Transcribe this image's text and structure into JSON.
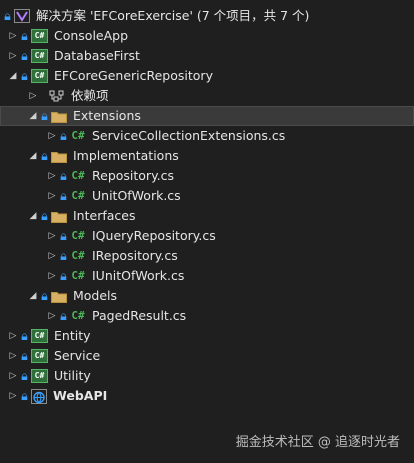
{
  "solution": {
    "label": "解决方案 'EFCoreExercise' (7 个项目，共 7 个)"
  },
  "projects": {
    "console_app": "ConsoleApp",
    "database_first": "DatabaseFirst",
    "generic_repo": "EFCoreGenericRepository",
    "entity": "Entity",
    "service": "Service",
    "utility": "Utility",
    "webapi": "WebAPI"
  },
  "repo": {
    "dependencies": "依赖项",
    "extensions": "Extensions",
    "service_collection_extensions": "ServiceCollectionExtensions.cs",
    "implementations": "Implementations",
    "repository": "Repository.cs",
    "unit_of_work": "UnitOfWork.cs",
    "interfaces": "Interfaces",
    "i_query_repository": "IQueryRepository.cs",
    "i_repository": "IRepository.cs",
    "i_unit_of_work": "IUnitOfWork.cs",
    "models": "Models",
    "paged_result": "PagedResult.cs"
  },
  "icons": {
    "project_badge": "C#",
    "cs_file": "C#"
  },
  "colors": {
    "background": "#1f1f1f",
    "selected_row": "#3a3a3a",
    "lock": "#3aa0ff",
    "csharp": "#4fb35a",
    "folder": "#d7b064"
  },
  "watermark": "掘金技术社区 @ 追逐时光者"
}
